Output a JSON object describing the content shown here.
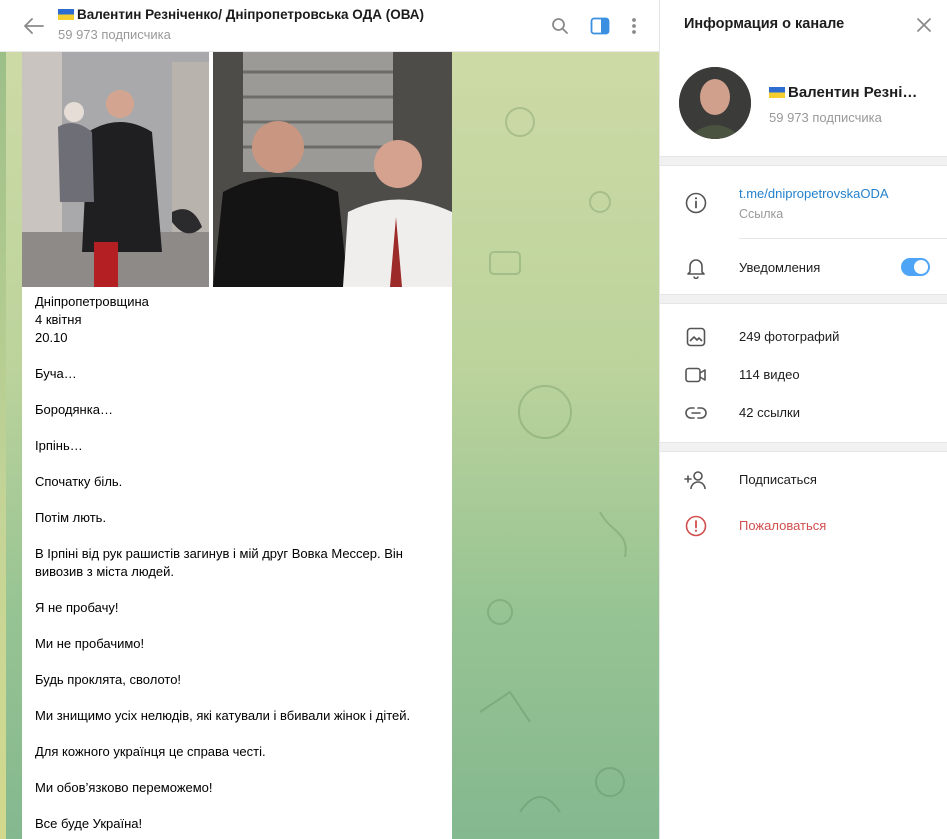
{
  "chat": {
    "title": "Валентин Резніченко/ Дніпропетровська ОДА (ОВА)",
    "subscribers": "59 973 подписчика",
    "message": {
      "lines": [
        "Дніпропетровщина",
        "4 квітня",
        "20.10",
        "Буча…",
        "Бородянка…",
        "Ірпінь…",
        "Спочатку біль.",
        "Потім лють.",
        "В Ірпіні від рук рашистів  загинув і мій друг Вовка Мессер. Він вивозив з міста людей.",
        "Я не пробачу!",
        "Ми не пробачимо!",
        "Будь проклята, сволото!",
        "Ми знищимо усіх нелюдів, які катували  і вбивали жінок і дітей.",
        "Для кожного українця це справа честі.",
        "Ми обов’язково переможемо!",
        "Все буде Україна!"
      ]
    }
  },
  "info": {
    "title": "Информация о канале",
    "channel_name": "Валентин Резні…",
    "subscribers": "59 973 подписчика",
    "link_value": "t.me/dnipropetrovskaODA",
    "link_label": "Ссылка",
    "notifications_label": "Уведомления",
    "notifications_on": true,
    "photos": "249 фотографий",
    "videos": "114 видео",
    "links": "42 ссылки",
    "subscribe": "Подписаться",
    "report": "Пожаловаться"
  },
  "colors": {
    "accent": "#4ea4f6",
    "link": "#2481cc",
    "danger": "#d14e4e"
  }
}
